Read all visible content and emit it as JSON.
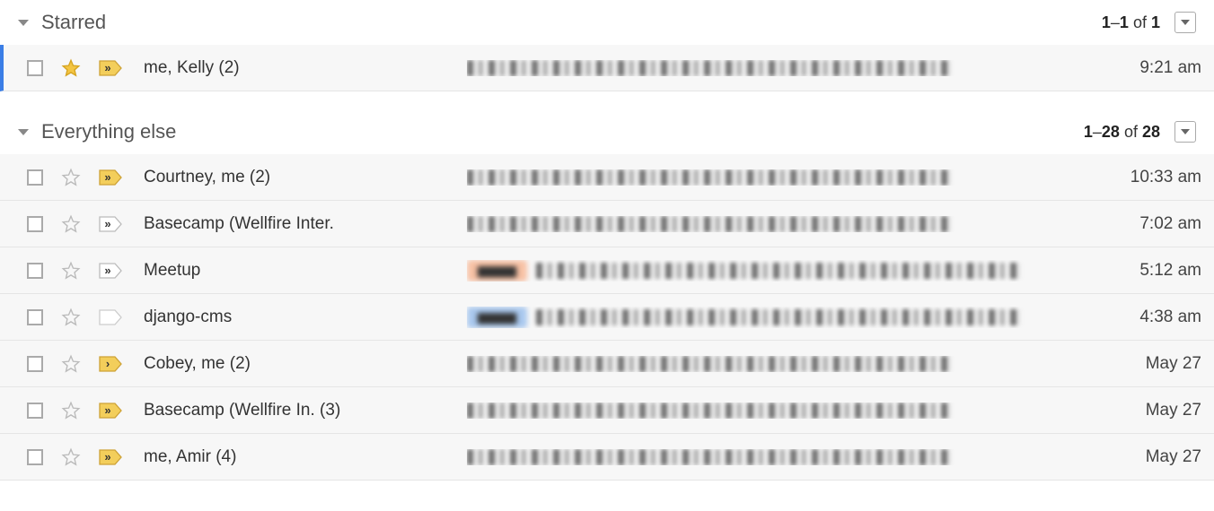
{
  "sections": [
    {
      "title": "Starred",
      "page_start": 1,
      "page_end": 1,
      "total": 1,
      "of_label": "of",
      "rows": [
        {
          "sender": "me, Kelly (2)",
          "time": "9:21 am",
          "starred": true,
          "marker": "yellow-double",
          "highlight": true,
          "tag": null
        }
      ]
    },
    {
      "title": "Everything else",
      "page_start": 1,
      "page_end": 28,
      "total": 28,
      "of_label": "of",
      "rows": [
        {
          "sender": "Courtney, me (2)",
          "time": "10:33 am",
          "starred": false,
          "marker": "yellow-double",
          "highlight": false,
          "tag": null
        },
        {
          "sender": "Basecamp (Wellfire Inter.",
          "time": "7:02 am",
          "starred": false,
          "marker": "white-double",
          "highlight": false,
          "tag": null
        },
        {
          "sender": "Meetup",
          "time": "5:12 am",
          "starred": false,
          "marker": "white-double",
          "highlight": false,
          "tag": "#f7c1a4"
        },
        {
          "sender": "django-cms",
          "time": "4:38 am",
          "starred": false,
          "marker": "white-empty",
          "highlight": false,
          "tag": "#a9c8ee"
        },
        {
          "sender": "Cobey, me (2)",
          "time": "May 27",
          "starred": false,
          "marker": "yellow-single",
          "highlight": false,
          "tag": null
        },
        {
          "sender": "Basecamp (Wellfire In. (3)",
          "time": "May 27",
          "starred": false,
          "marker": "yellow-double",
          "highlight": false,
          "tag": null
        },
        {
          "sender": "me, Amir (4)",
          "time": "May 27",
          "starred": false,
          "marker": "yellow-double",
          "highlight": false,
          "tag": null
        }
      ]
    }
  ]
}
